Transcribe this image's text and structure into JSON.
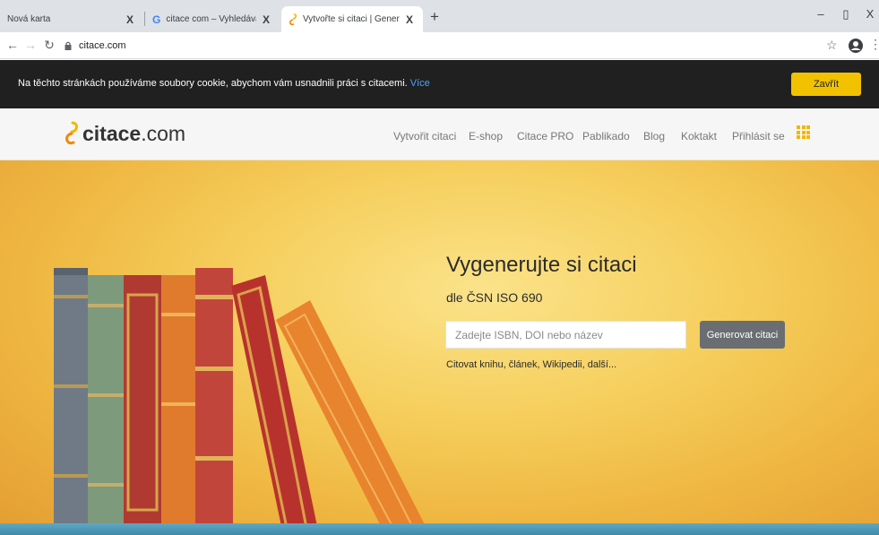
{
  "browser": {
    "tabs": [
      {
        "title": "Nová karta",
        "close": "X"
      },
      {
        "title": "citace com – Vyhledávání Google",
        "close": "X",
        "favicon": "google-g-icon"
      },
      {
        "title": "Vytvořte si citaci | Generátor Cita",
        "close": "X",
        "active": true,
        "favicon": "citace-logo-icon"
      }
    ],
    "new_tab": "+",
    "window_controls": {
      "minimize": "–",
      "maximize": "▯",
      "close": "X"
    },
    "url": "citace.com"
  },
  "cookie_bar": {
    "text": "Na těchto stránkách používáme soubory cookie, abychom vám usnadnili práci s citacemi.",
    "link": "Více",
    "button": "Zavřít"
  },
  "header": {
    "logo_bold": "citace",
    "logo_light": ".com",
    "nav": [
      "Vytvořit citaci",
      "E-shop",
      "Citace PRO",
      "Pablikado",
      "Blog",
      "Koktakt",
      "Přihlásit se"
    ]
  },
  "hero": {
    "title": "Vygenerujte si citaci",
    "subtitle": "dle ČSN ISO 690",
    "search_placeholder": "Zadejte ISBN, DOI nebo název",
    "button": "Generovat citaci",
    "hint": "Citovat knihu, článek, Wikipedii, další..."
  },
  "colors": {
    "accent": "#f2c200",
    "cookie_bg": "#202020",
    "link": "#4aa3ff",
    "button_gray": "#6a6e73"
  }
}
